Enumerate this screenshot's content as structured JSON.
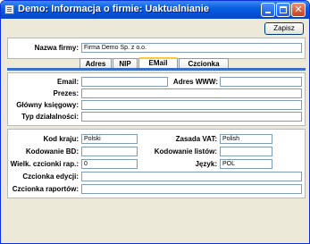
{
  "window": {
    "title": "Demo: Informacja o firmie: Uaktualnianie"
  },
  "toolbar": {
    "save_label": "Zapisz"
  },
  "company": {
    "name_label": "Nazwa firmy:",
    "name_value": "Firma Demo Sp. z o.o."
  },
  "tabs": [
    {
      "label": "Adres",
      "active": false
    },
    {
      "label": "NIP",
      "active": false
    },
    {
      "label": "EMail",
      "active": true
    },
    {
      "label": "Czcionka",
      "active": false
    }
  ],
  "email_tab": {
    "email_label": "Email:",
    "email_value": "",
    "www_label": "Adres WWW:",
    "www_value": "",
    "prezes_label": "Prezes:",
    "prezes_value": "",
    "ksiegowy_label": "Główny księgowy:",
    "ksiegowy_value": "",
    "typ_label": "Typ działalności:",
    "typ_value": ""
  },
  "settings": {
    "kod_kraju_label": "Kod kraju:",
    "kod_kraju_value": "Polski",
    "zasada_vat_label": "Zasada VAT:",
    "zasada_vat_value": "Polish",
    "kod_bd_label": "Kodowanie BD:",
    "kod_bd_value": "",
    "kod_listow_label": "Kodowanie listów:",
    "kod_listow_value": "",
    "wielk_label": "Wielk. czcionki rap.:",
    "wielk_value": "0",
    "jezyk_label": "Język:",
    "jezyk_value": "POL",
    "czc_edycji_label": "Czcionka edycji:",
    "czc_edycji_value": "",
    "czc_raportow_label": "Czcionka raportów:",
    "czc_raportow_value": ""
  }
}
